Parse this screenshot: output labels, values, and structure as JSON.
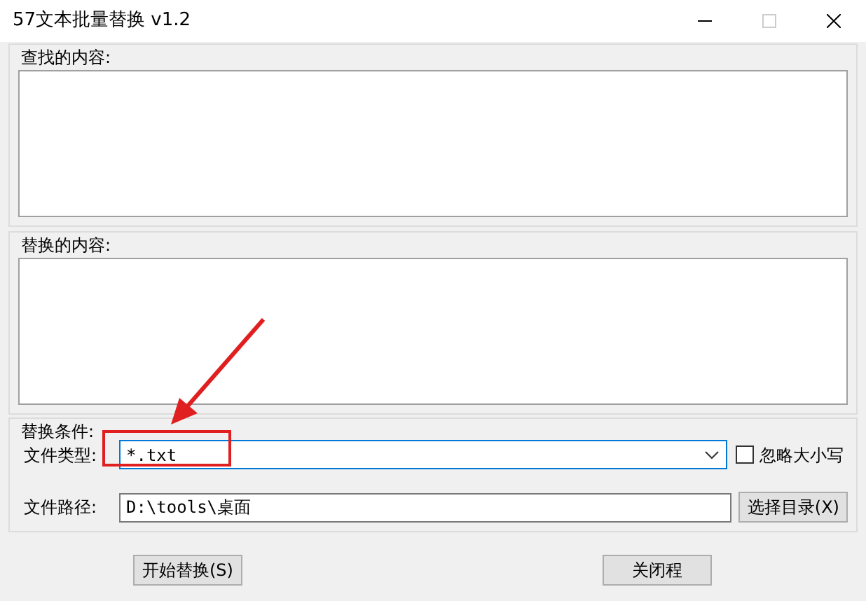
{
  "window": {
    "title": "57文本批量替换 v1.2"
  },
  "find_group": {
    "label": "查找的内容:"
  },
  "replace_group": {
    "label": "替换的内容:"
  },
  "conditions": {
    "label": "替换条件:",
    "file_type": {
      "label": "文件类型:",
      "value": "*.txt"
    },
    "ignore_case": {
      "label": "忽略大小写",
      "checked": false
    },
    "file_path": {
      "label": "文件路径:",
      "value": "D:\\tools\\桌面"
    },
    "browse_button": "选择目录(X)"
  },
  "buttons": [
    "开始替换(S)",
    "关闭程"
  ]
}
